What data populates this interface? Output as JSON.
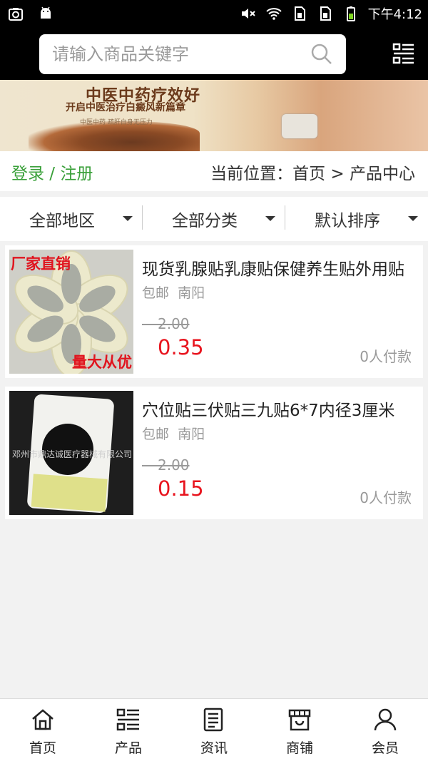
{
  "status_bar": {
    "time": "下午4:12",
    "icons": [
      "screenshot-icon",
      "android-icon",
      "mute-icon",
      "wifi-icon",
      "sim1-icon",
      "sim2-icon",
      "battery-icon"
    ]
  },
  "search": {
    "placeholder": "请输入商品关键字",
    "value": ""
  },
  "banner": {
    "headline": "中医中药疗效好",
    "subline": "开启中医治疗白癜风新篇章",
    "small_text": "中医中药  疏肝白身无压力"
  },
  "breadcrumb": {
    "login_label": "登录 / 注册",
    "position_label": "当前位置：首页 > 产品中心"
  },
  "filters": [
    {
      "label": "全部地区"
    },
    {
      "label": "全部分类"
    },
    {
      "label": "默认排序"
    }
  ],
  "products": [
    {
      "title": "现货乳腺贴乳康贴保健养生贴外用贴",
      "shipping": "包邮",
      "location": "南阳",
      "original_price": "2.00",
      "price": "0.35",
      "sold": "0人付款",
      "thumb_text_top": "厂家直销",
      "thumb_text_bottom": "量大从优"
    },
    {
      "title": "穴位贴三伏贴三九贴6*7内径3厘米",
      "shipping": "包邮",
      "location": "南阳",
      "original_price": "2.00",
      "price": "0.15",
      "sold": "0人付款",
      "thumb_watermark": "邓州市鼎达诚医疗器械有限公司"
    }
  ],
  "tab_bar": [
    {
      "label": "首页",
      "icon": "home-icon"
    },
    {
      "label": "产品",
      "icon": "products-icon"
    },
    {
      "label": "资讯",
      "icon": "news-icon"
    },
    {
      "label": "商铺",
      "icon": "store-icon"
    },
    {
      "label": "会员",
      "icon": "member-icon"
    }
  ],
  "colors": {
    "accent_green": "#3aa03a",
    "price_red": "#e8141e",
    "header_bg": "#000000"
  }
}
